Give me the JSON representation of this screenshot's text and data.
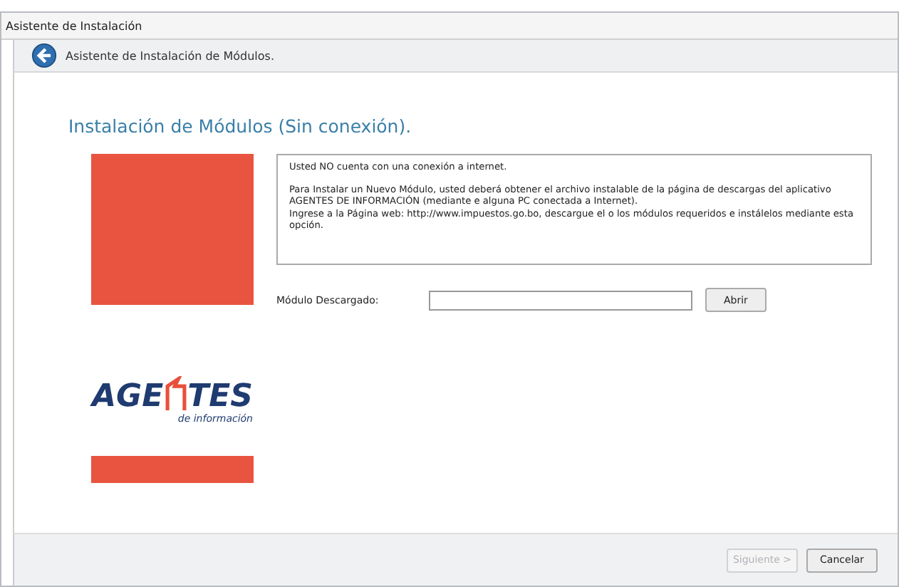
{
  "window": {
    "title": "Asistente de Instalación"
  },
  "header": {
    "title": "Asistente de Instalación de Módulos."
  },
  "heading": "Instalación de Módulos (Sin conexión).",
  "logo": {
    "left": "AGE",
    "right": "TES",
    "subtitle": "de información"
  },
  "info": [
    "Usted NO cuenta con una conexión a internet.",
    "Para Instalar un Nuevo Módulo, usted deberá obtener el archivo instalable de la página de descargas del aplicativo AGENTES DE INFORMACIÓN (mediante e alguna PC conectada a Internet).\nIngrese a  la Página web:  http://www.impuestos.go.bo, descargue el o los módulos requeridos e instálelos mediante esta opción."
  ],
  "module_field": {
    "label": "Módulo Descargado:"
  },
  "open_button": "Abrir",
  "buttons": [
    {
      "label": "Siguiente >",
      "disabled": true
    },
    {
      "label": "Cancelar",
      "disabled": false
    }
  ]
}
